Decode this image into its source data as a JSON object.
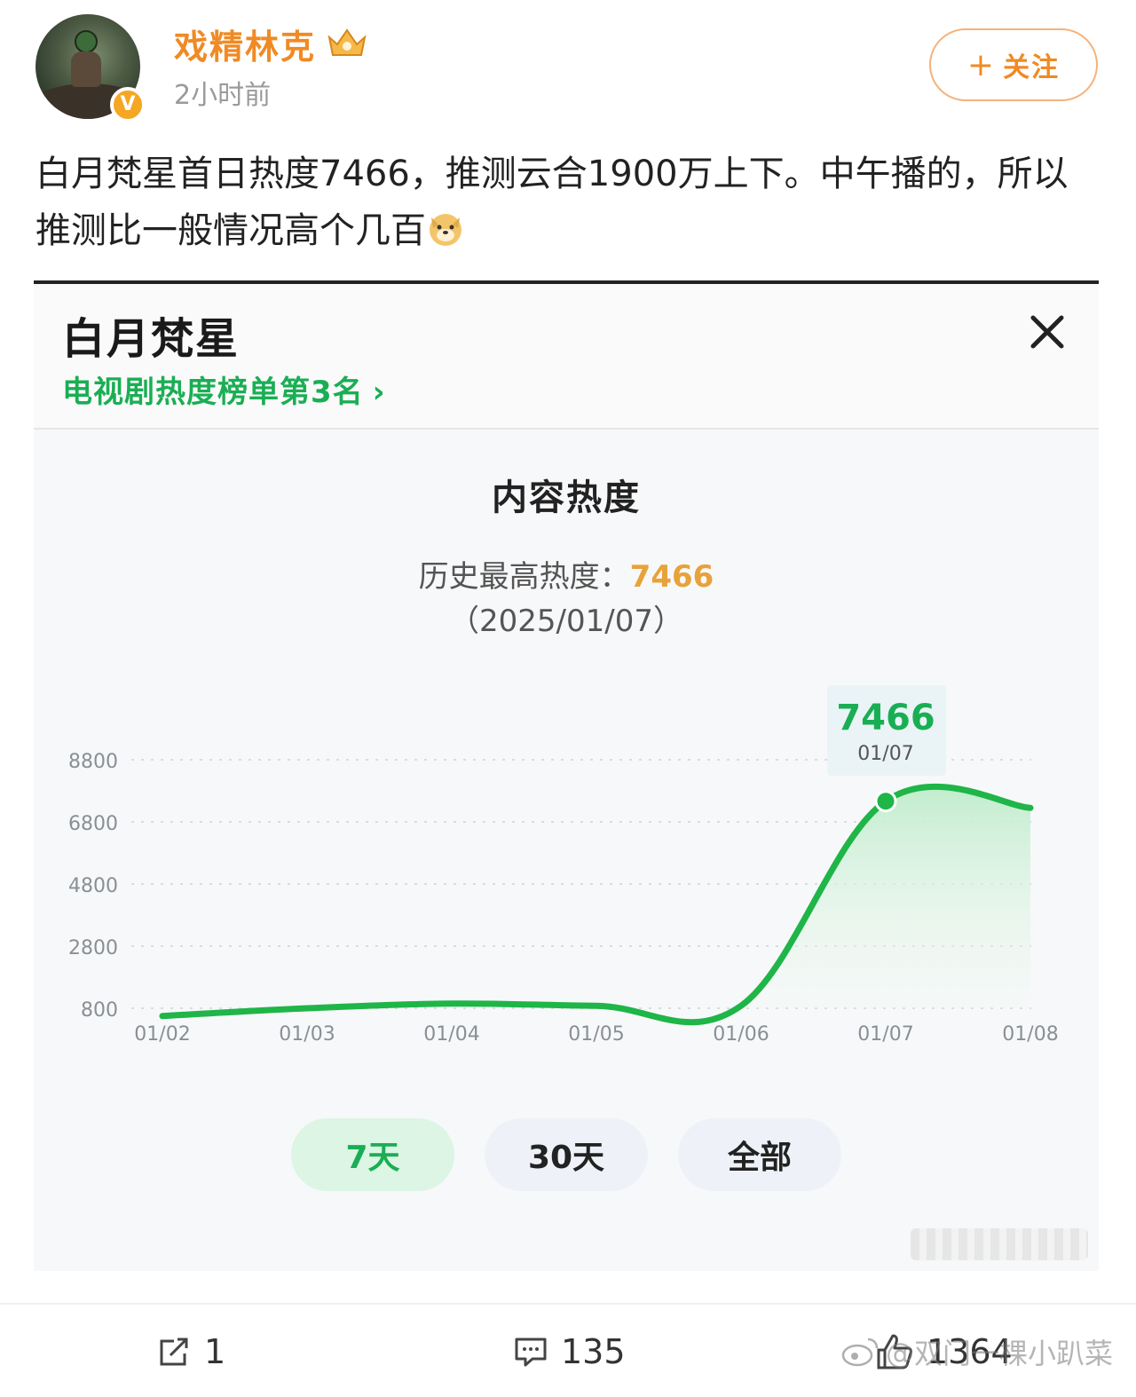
{
  "post": {
    "username": "戏精林克",
    "time": "2小时前",
    "follow_label": "关注",
    "text": "白月梵星首日热度7466，推测云合1900万上下。中午播的，所以推测比一般情况高个几百"
  },
  "card": {
    "title": "白月梵星",
    "subtitle": "电视剧热度榜单第3名",
    "section_title": "内容热度",
    "peak_label": "历史最高热度：",
    "peak_value": "7466",
    "peak_date": "（2025/01/07）",
    "range_buttons": [
      "7天",
      "30天",
      "全部"
    ]
  },
  "chart_data": {
    "type": "area",
    "x": [
      "01/02",
      "01/03",
      "01/04",
      "01/05",
      "01/06",
      "01/07",
      "01/08"
    ],
    "series": [
      {
        "values": [
          550,
          800,
          950,
          880,
          880,
          7466,
          7250
        ]
      }
    ],
    "y_ticks": [
      "8800",
      "6800",
      "4800",
      "2800",
      "800"
    ],
    "ylim": [
      800,
      8800
    ],
    "grid": true,
    "tooltip": {
      "value": "7466",
      "date": "01/07"
    },
    "colors": {
      "line": "#1fb548",
      "fill": "#c8efd3"
    }
  },
  "footer": {
    "share_count": "1",
    "comment_count": "135",
    "like_count": "1364",
    "watermark": "@双门一棵小趴菜"
  },
  "colors": {
    "accent_orange": "#f08a24",
    "accent_green": "#1aae54"
  }
}
